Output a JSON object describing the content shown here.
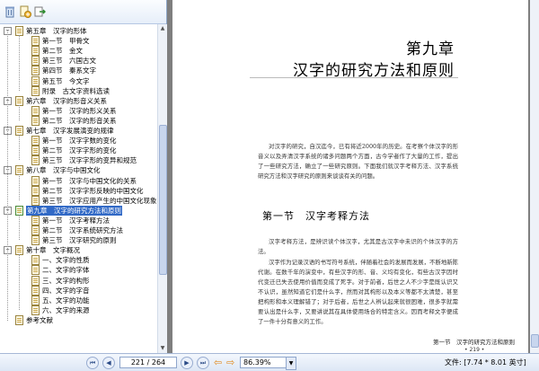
{
  "sidebar": {
    "toolbar_icons": [
      "delete-icon",
      "add-bookmark-icon",
      "export-icon"
    ],
    "items": [
      {
        "label": "第五章　汉字的形体",
        "level": 0,
        "expanded": true
      },
      {
        "label": "第一节　甲骨文",
        "level": 1
      },
      {
        "label": "第二节　金文",
        "level": 1
      },
      {
        "label": "第三节　六国古文",
        "level": 1
      },
      {
        "label": "第四节　秦系文字",
        "level": 1
      },
      {
        "label": "第五节　今文字",
        "level": 1
      },
      {
        "label": "附录　古文字资料选读",
        "level": 1
      },
      {
        "label": "第六章　汉字的形音义关系",
        "level": 0,
        "expanded": true
      },
      {
        "label": "第一节　汉字的形义关系",
        "level": 1
      },
      {
        "label": "第二节　汉字的形音关系",
        "level": 1
      },
      {
        "label": "第七章　汉字发展演变的规律",
        "level": 0,
        "expanded": true
      },
      {
        "label": "第一节　汉字字数的变化",
        "level": 1
      },
      {
        "label": "第二节　汉字字形的变化",
        "level": 1
      },
      {
        "label": "第三节　汉字字形的变异和规范",
        "level": 1
      },
      {
        "label": "第八章　汉字与中国文化",
        "level": 0,
        "expanded": true
      },
      {
        "label": "第一节　汉字与中国文化的关系",
        "level": 1
      },
      {
        "label": "第二节　汉字字形反映的中国文化",
        "level": 1
      },
      {
        "label": "第三节　汉字应用产生的中国文化现象",
        "level": 1
      },
      {
        "label": "第九章　汉字的研究方法和原则",
        "level": 0,
        "expanded": true,
        "selected": true
      },
      {
        "label": "第一节　汉字考释方法",
        "level": 1
      },
      {
        "label": "第二节　汉字系统研究方法",
        "level": 1
      },
      {
        "label": "第三节　汉字研究的原则",
        "level": 1
      },
      {
        "label": "第十章　文字概况",
        "level": 0,
        "expanded": true
      },
      {
        "label": "一、文字的性质",
        "level": 1
      },
      {
        "label": "二、文字的字体",
        "level": 1
      },
      {
        "label": "三、文字的构形",
        "level": 1
      },
      {
        "label": "四、文字的字音",
        "level": 1
      },
      {
        "label": "五、文字的功能",
        "level": 1
      },
      {
        "label": "六、文字的来源",
        "level": 1
      },
      {
        "label": "参考文献",
        "level": 0
      }
    ]
  },
  "document": {
    "chapter_number": "第九章",
    "chapter_title": "汉字的研究方法和原则",
    "intro_paragraph": "对汉字的研究，自汉迄今，已有将近2000年的历史。在考察个体汉字的形音义以及弄清汉字系统的诸多问题两个方面，古今学者作了大量的工作，提出了一些研究方法，确立了一些研究原则。下面我们就汉字考释方法、汉字系统研究方法和汉字研究的原则来谈谈有关的问题。",
    "section_title": "第一节　汉字考释方法",
    "section_paragraph_1": "汉字考释方法，是辨识读个体汉字，尤其是古汉字中未识的个体汉字的方法。",
    "section_paragraph_2": "汉字作为记录汉语的书写符号系统，伴随着社会的发展而发展，不断地新陈代谢。在数千年的演变中，有些汉字的形、音、义均有变化，有些古汉字因时代变迁已失去使用价值而变成了死字。对于前者，后世之人不少字是既认识又不认识，虽然知道它们是什么字，然而对其构形以及本义等都不太清楚，甚至把构形和本义理解错了；对于后者，后世之人辨认起来就很困难，很多字就需要认出是什么字，又要讲说其在具体使用场合的特定含义。因而考释文字便成了一件十分有意义的工作。",
    "footer_running_title": "第一节　汉字的研究方法和原则",
    "footer_page_number": "• 219 •"
  },
  "statusbar": {
    "page_display": "221 / 264",
    "zoom": "86.39%",
    "file_size_label": "文件: [7.74 * 8.01 英寸]",
    "nav_icons": [
      "first-page-icon",
      "prev-page-icon",
      "next-page-icon",
      "last-page-icon",
      "back-icon",
      "forward-icon"
    ]
  }
}
